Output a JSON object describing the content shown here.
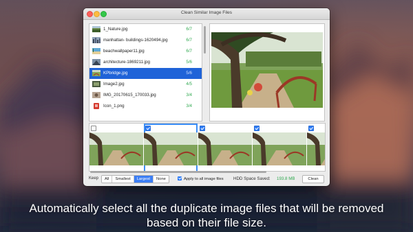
{
  "window": {
    "title": "Clean Similar Image Files"
  },
  "files": [
    {
      "name": "1_Nature.jpg",
      "count": "6/7",
      "icon": "nature-thumb"
    },
    {
      "name": "manhattan- buildings-1620494.jpg",
      "count": "6/7",
      "icon": "city-thumb"
    },
    {
      "name": "beachwallpaper11.jpg",
      "count": "6/7",
      "icon": "beach-thumb"
    },
    {
      "name": "architecture-1869211.jpg",
      "count": "5/6",
      "icon": "architecture-thumb"
    },
    {
      "name": "KPbridge.jpg",
      "count": "5/6",
      "icon": "bridge-thumb"
    },
    {
      "name": "Image2.jpg",
      "count": "4/5",
      "icon": "image-thumb"
    },
    {
      "name": "IMG_20170615_170033.jpg",
      "count": "3/4",
      "icon": "photo-thumb"
    },
    {
      "name": "Icon_1.png",
      "count": "3/4",
      "icon": "red-icon-thumb"
    }
  ],
  "selected_file": "KPbridge.jpg",
  "thumbnails": [
    {
      "checked": false
    },
    {
      "checked": true,
      "highlighted": true
    },
    {
      "checked": true
    },
    {
      "checked": true
    },
    {
      "checked": true
    }
  ],
  "bottom": {
    "keep_label": "Keep",
    "keep_options": [
      "All",
      "Smallest",
      "Largest",
      "None"
    ],
    "keep_selected": "Largest",
    "apply_all_label": "Apply to all image files",
    "apply_all_checked": true,
    "saved_label": "HDD Space Saved:",
    "saved_value": "193.8 MB",
    "clean_label": "Clean"
  },
  "caption": "Automatically select all the duplicate image files that will be removed based on their file size.",
  "colors": {
    "accent": "#1f63d8",
    "count_green": "#2fa84f",
    "selection_border": "#3b8ef7"
  }
}
